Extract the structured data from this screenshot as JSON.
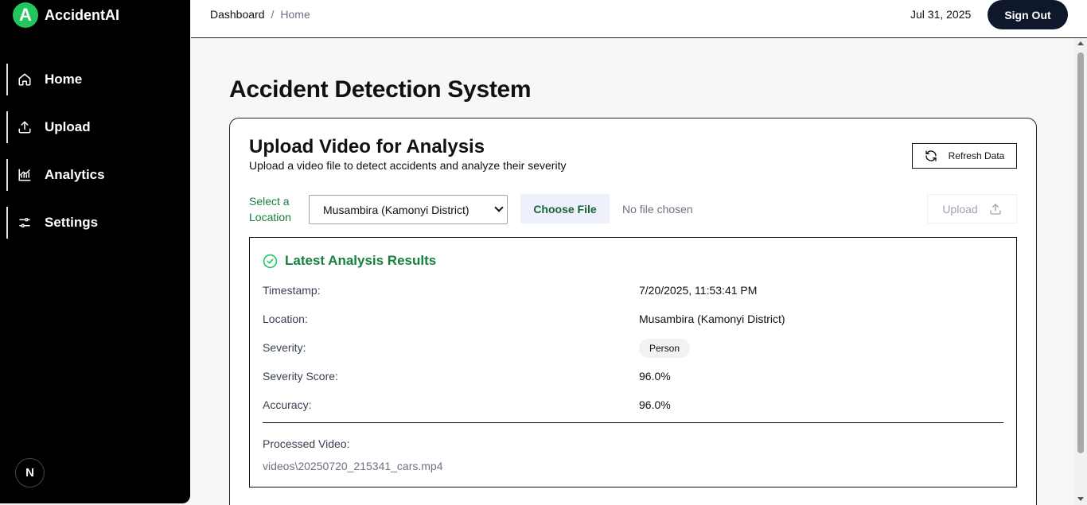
{
  "app": {
    "logo_letter": "A",
    "name": "AccidentAI"
  },
  "sidebar": {
    "items": [
      {
        "label": "Home",
        "icon": "home-icon"
      },
      {
        "label": "Upload",
        "icon": "upload-icon"
      },
      {
        "label": "Analytics",
        "icon": "analytics-icon"
      },
      {
        "label": "Settings",
        "icon": "settings-icon"
      }
    ],
    "avatar_letter": "N"
  },
  "header": {
    "breadcrumb": [
      "Dashboard",
      "/",
      "Home"
    ],
    "date": "Jul 31, 2025",
    "signout_label": "Sign Out"
  },
  "main": {
    "title": "Accident Detection System",
    "card": {
      "title": "Upload Video for Analysis",
      "subtitle": "Upload a video file to detect accidents and analyze their severity",
      "refresh_label": "Refresh Data",
      "location_label": "Select a Location",
      "location_value": "Musambira (Kamonyi District)",
      "choose_file_label": "Choose File",
      "file_status": "No file chosen",
      "upload_label": "Upload"
    },
    "results": {
      "title": "Latest Analysis Results",
      "rows": [
        {
          "label": "Timestamp:",
          "value": "7/20/2025, 11:53:41 PM"
        },
        {
          "label": "Location:",
          "value": "Musambira (Kamonyi District)"
        },
        {
          "label": "Severity:",
          "value": "Person"
        },
        {
          "label": "Severity Score:",
          "value": "96.0%"
        },
        {
          "label": "Accuracy:",
          "value": "96.0%"
        }
      ],
      "video_label": "Processed Video:",
      "video_path": "videos\\20250720_215341_cars.mp4"
    }
  },
  "colors": {
    "accent_green": "#22c55e",
    "text_green": "#15803d",
    "dark": "#0f172a"
  }
}
